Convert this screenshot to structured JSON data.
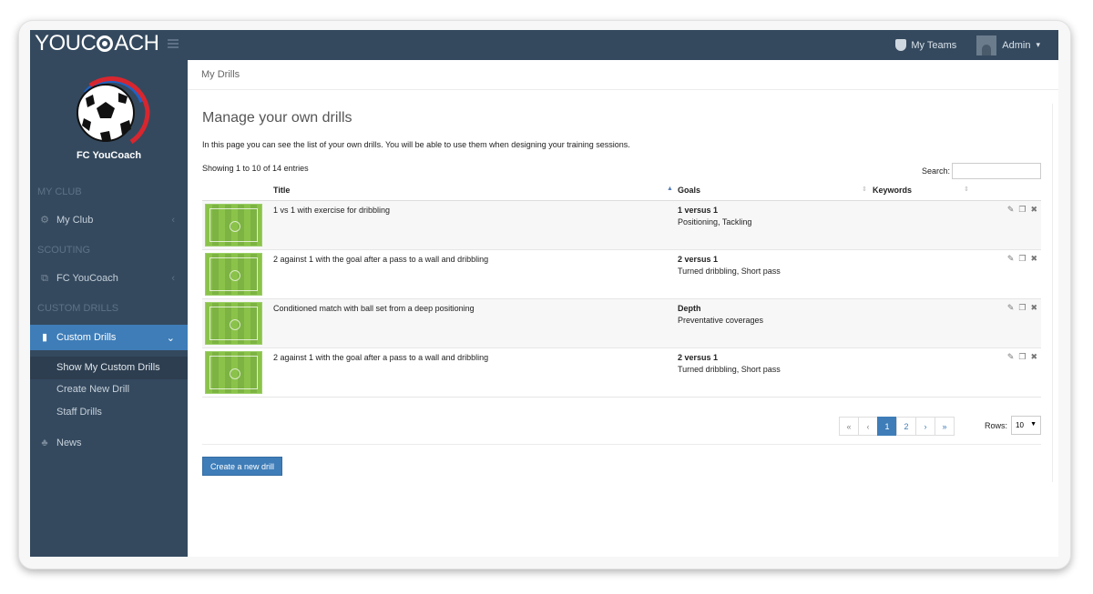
{
  "app": {
    "logo_text_left": "YOUC",
    "logo_text_right": "ACH",
    "nav_right": {
      "my_teams": "My Teams",
      "admin": "Admin"
    }
  },
  "sidebar": {
    "club_name": "FC YouCoach",
    "sections": {
      "my_club": "MY CLUB",
      "scouting": "SCOUTING",
      "custom_drills": "CUSTOM DRILLS"
    },
    "items": {
      "my_club": "My Club",
      "fc_youcoach": "FC YouCoach",
      "custom_drills": "Custom Drills",
      "news": "News"
    },
    "sub_items": {
      "show": "Show My Custom Drills",
      "create": "Create New Drill",
      "staff": "Staff Drills"
    }
  },
  "main": {
    "breadcrumb": "My Drills",
    "title": "Manage your own drills",
    "description": "In this page you can see the list of your own drills. You will be able to use them when designing your training sessions.",
    "entries_info": "Showing 1 to 10 of 14 entries",
    "search_label": "Search:",
    "search_value": "",
    "columns": {
      "title": "Title",
      "goals": "Goals",
      "keywords": "Keywords"
    },
    "rows": [
      {
        "title": "1 vs 1 with exercise for dribbling",
        "goal": "1 versus 1",
        "goal_detail": "Positioning, Tackling"
      },
      {
        "title": "2 against 1 with the goal after a pass to a wall and dribbling",
        "goal": "2 versus 1",
        "goal_detail": "Turned dribbling, Short pass"
      },
      {
        "title": "Conditioned match with ball set from a deep positioning",
        "goal": "Depth",
        "goal_detail": "Preventative coverages"
      },
      {
        "title": "2 against 1 with the goal after a pass to a wall and dribbling",
        "goal": "2 versus 1",
        "goal_detail": "Turned dribbling, Short pass"
      }
    ],
    "pagination": {
      "first": "«",
      "prev": "‹",
      "page1": "1",
      "page2": "2",
      "next": "›",
      "last": "»",
      "rows_label": "Rows:",
      "rows_value": "10"
    },
    "create_button": "Create a new drill"
  }
}
